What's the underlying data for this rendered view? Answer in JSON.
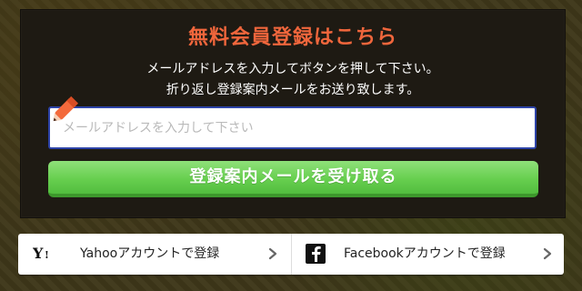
{
  "signup": {
    "title": "無料会員登録はこちら",
    "description_line1": "メールアドレスを入力してボタンを押して下さい。",
    "description_line2": "折り返し登録案内メールをお送り致します。",
    "email_placeholder": "メールアドレスを入力して下さい",
    "email_value": "",
    "submit_label": "登録案内メールを受け取る"
  },
  "social": {
    "yahoo_label": "Yahooアカウントで登録",
    "facebook_label": "Facebookアカウントで登録"
  },
  "icons": {
    "pencil": "pencil-icon",
    "yahoo": "yahoo-logo-icon",
    "facebook": "facebook-logo-icon",
    "chevron": "chevron-right-icon"
  },
  "colors": {
    "title": "#f0663c",
    "panel_background": "#1e1a13",
    "input_border": "#2d43a8",
    "button_green": "#67cf4f"
  }
}
